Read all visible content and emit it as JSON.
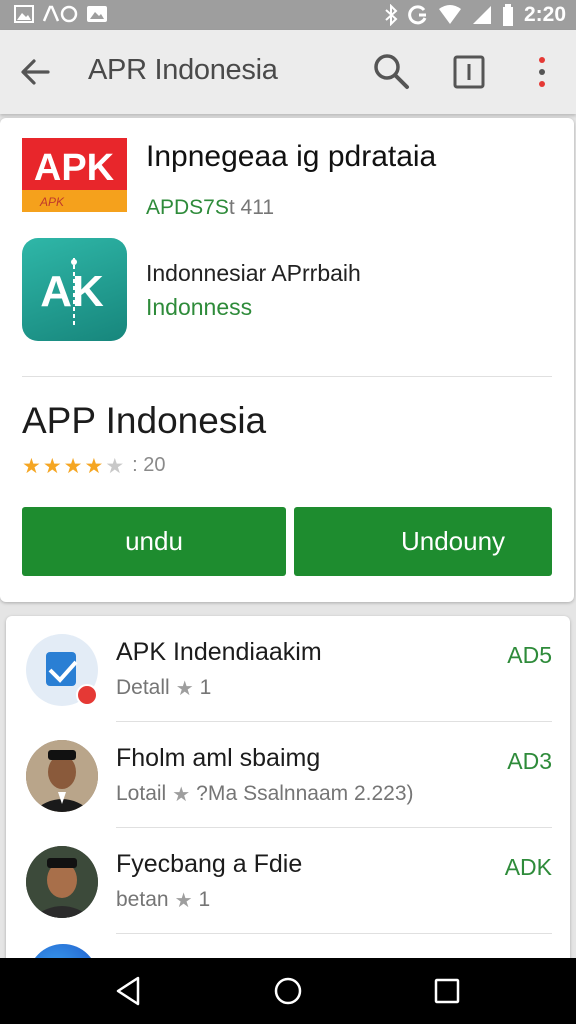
{
  "status_bar": {
    "time": "2:20"
  },
  "app_bar": {
    "title": "APR Indonesia"
  },
  "header": {
    "logo_text": "APK",
    "logo_subtext": "APK",
    "title": "Inpnegeaa ig pdrataia",
    "subtitle_green": "APDS7S",
    "subtitle_gray": "t 411"
  },
  "developer": {
    "icon_text": "AK",
    "name": "Indonnesiar APrrbaih",
    "sub": "Indonness"
  },
  "app": {
    "name": "APP Indonesia",
    "rating_stars": 3.5,
    "rating_count": ": 20",
    "install_button": "undu",
    "other_button": "Undouny"
  },
  "list": {
    "items": [
      {
        "title": "APK Indendiaakim",
        "sub": "Detall",
        "stars": "1",
        "tag": "AD5"
      },
      {
        "title": "Fholm aml sbaimg",
        "sub": "Lotail",
        "stars": "?Ма Ssalnnaam 2.223)",
        "tag": "AD3"
      },
      {
        "title": "Fyecbang a Fdie",
        "sub": "betan",
        "stars": "1",
        "tag": "ADK"
      }
    ]
  },
  "colors": {
    "accent_green": "#1e8c2f",
    "link_green": "#2e8b3a",
    "star_gold": "#f5a623",
    "status_bar": "#9e9e9e"
  }
}
